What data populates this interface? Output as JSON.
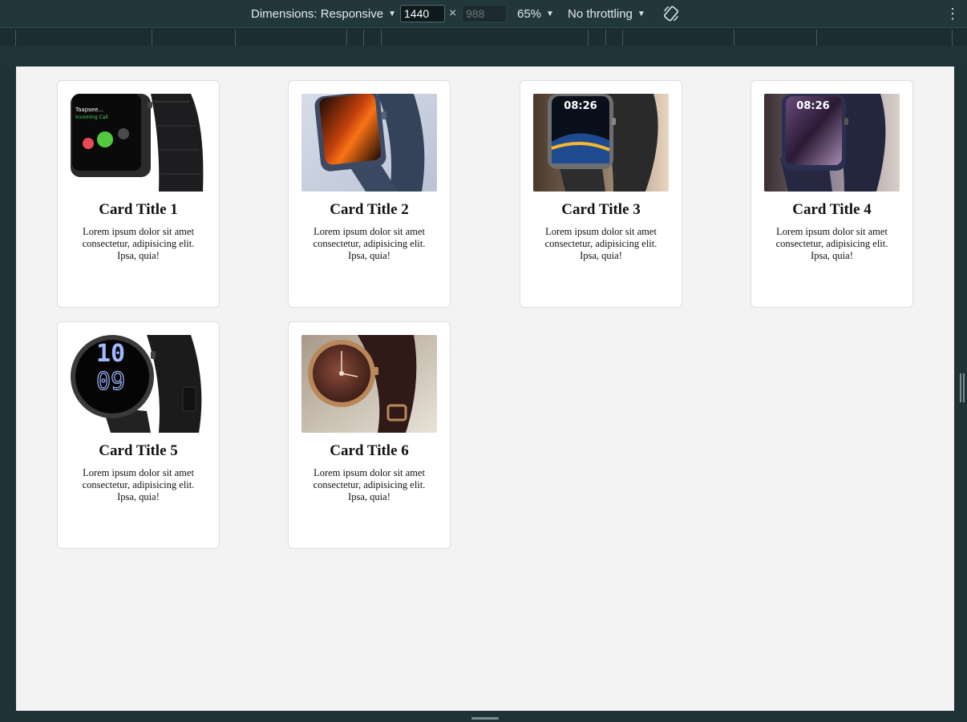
{
  "toolbar": {
    "dimensions_label": "Dimensions: Responsive",
    "width_value": "1440",
    "times": "×",
    "height_placeholder": "988",
    "zoom": "65%",
    "throttling": "No throttling",
    "more": "⋮"
  },
  "cards": [
    {
      "title": "Card Title 1",
      "text": "Lorem ipsum dolor sit amet consectetur, adipisicing elit. Ipsa, quia!",
      "image": "smartwatch-incoming-call",
      "screen_text": "Taapsee... Incoming Call"
    },
    {
      "title": "Card Title 2",
      "text": "Lorem ipsum dolor sit amet consectetur, adipisicing elit. Ipsa, quia!",
      "image": "smartwatch-orange-wave"
    },
    {
      "title": "Card Title 3",
      "text": "Lorem ipsum dolor sit amet consectetur, adipisicing elit. Ipsa, quia!",
      "image": "smartwatch-time-display",
      "screen_text": "08:26"
    },
    {
      "title": "Card Title 4",
      "text": "Lorem ipsum dolor sit amet consectetur, adipisicing elit. Ipsa, quia!",
      "image": "smartwatch-purple-time",
      "screen_text": "08:26"
    },
    {
      "title": "Card Title 5",
      "text": "Lorem ipsum dolor sit amet consectetur, adipisicing elit. Ipsa, quia!",
      "image": "round-smartwatch-digital",
      "screen_text": "10 09"
    },
    {
      "title": "Card Title 6",
      "text": "Lorem ipsum dolor sit amet consectetur, adipisicing elit. Ipsa, quia!",
      "image": "round-watch-brown-strap"
    }
  ],
  "colors": {
    "toolbar_bg": "#22373c",
    "viewport_bg": "#f3f3f3",
    "card_bg": "#ffffff"
  }
}
